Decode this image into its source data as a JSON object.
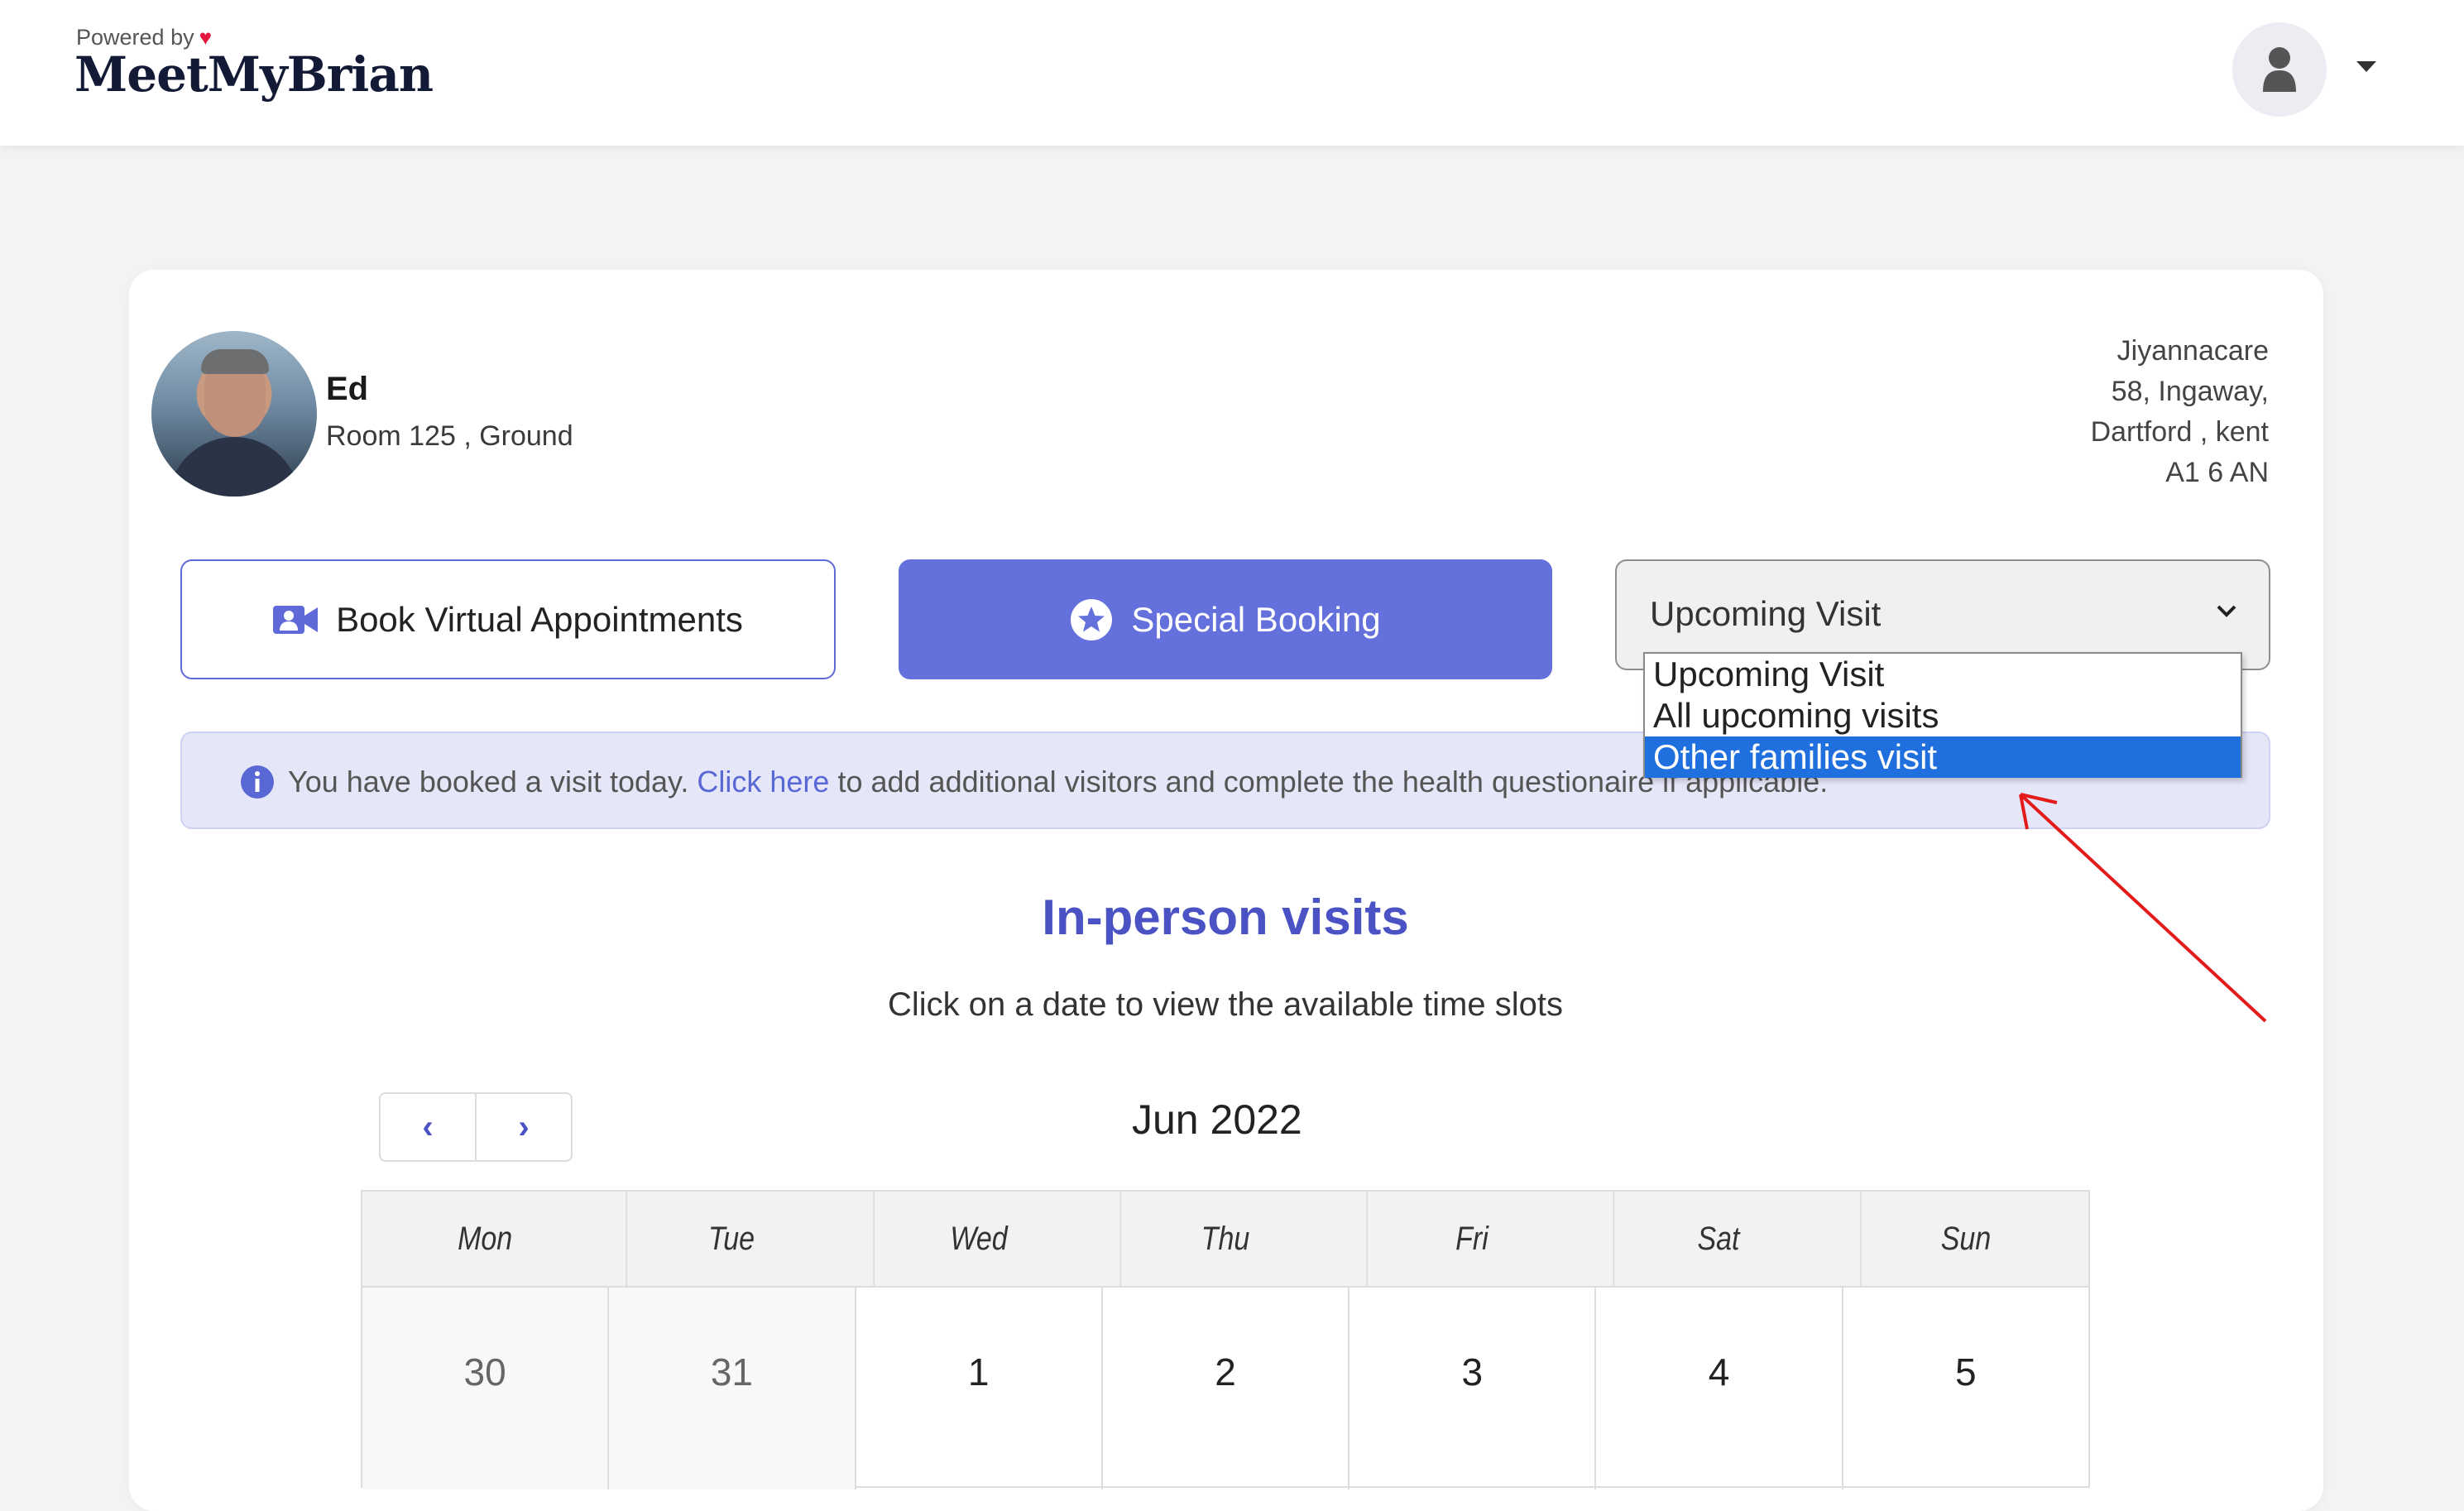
{
  "header": {
    "powered_by": "Powered by",
    "brand": "MeetMyBrian"
  },
  "resident": {
    "name": "Ed",
    "room": "Room 125 , Ground"
  },
  "address": {
    "line1": "Jiyannacare",
    "line2": "58, Ingaway,",
    "line3": "Dartford , kent",
    "line4": "A1 6 AN"
  },
  "actions": {
    "virtual_label": "Book Virtual Appointments",
    "special_label": "Special Booking"
  },
  "visit_select": {
    "value": "Upcoming Visit",
    "options": [
      "Upcoming Visit",
      "All upcoming visits",
      "Other families visit"
    ],
    "highlighted_option": "Other families visit"
  },
  "alert": {
    "prefix": "You have booked a visit today.",
    "link": "Click here",
    "suffix": "to add additional visitors and complete the health questionaire if applicable."
  },
  "section": {
    "title": "In-person visits",
    "subtitle": "Click on a date to view the available time slots"
  },
  "calendar": {
    "month": "Jun 2022",
    "prev": "‹",
    "next": "›",
    "weekdays": [
      "Mon",
      "Tue",
      "Wed",
      "Thu",
      "Fri",
      "Sat",
      "Sun"
    ],
    "first_week": [
      "30",
      "31",
      "1",
      "2",
      "3",
      "4",
      "5"
    ]
  },
  "colors": {
    "accent": "#6470dc",
    "title": "#4a52c4",
    "alert_bg": "#e5e6f8",
    "highlight": "#1f6fde",
    "annotation": "#e31b1b"
  }
}
